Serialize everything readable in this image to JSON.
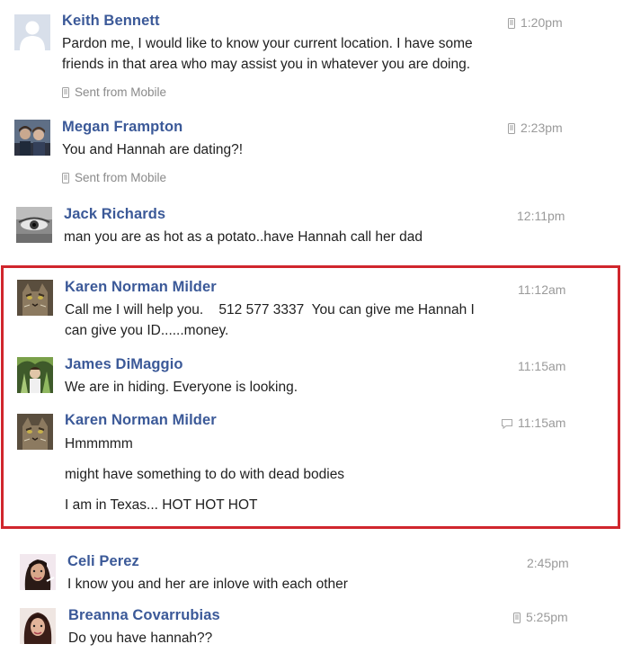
{
  "highlight_color": "#d0262d",
  "link_color": "#3b5998",
  "messages": [
    {
      "name": "Keith Bennett",
      "time": "1:20pm",
      "mobile": true,
      "lines": [
        "Pardon me, I would like to know your current location. I have some",
        "friends in that area who may assist you in whatever you are doing."
      ],
      "footer": "Sent from Mobile",
      "avatar": "default-silhouette"
    },
    {
      "name": "Megan Frampton",
      "time": "2:23pm",
      "mobile": true,
      "lines": [
        "You and Hannah are dating?!"
      ],
      "footer": "Sent from Mobile",
      "avatar": "photo"
    },
    {
      "name": "Jack Richards",
      "time": "12:11pm",
      "lines": [
        "man you are as hot as a potato..have Hannah call her dad"
      ],
      "avatar": "photo"
    },
    {
      "name": "Karen Norman Milder",
      "time": "11:12am",
      "lines": [
        "Call me I will help you.    512 577 3337  You can give me Hannah I",
        "can give you ID......money."
      ],
      "avatar": "cat-photo"
    },
    {
      "name": "James DiMaggio",
      "time": "11:15am",
      "lines": [
        "We are in hiding. Everyone is looking."
      ],
      "avatar": "photo"
    },
    {
      "name": "Karen Norman Milder",
      "time": "11:15am",
      "chat": true,
      "lines": [
        "Hmmmmm",
        "might have something to do with dead bodies",
        "I am in Texas... HOT HOT HOT"
      ],
      "avatar": "cat-photo"
    },
    {
      "name": "Celi Perez",
      "time": "2:45pm",
      "lines": [
        "I know you and her are inlove with each other"
      ],
      "avatar": "photo"
    },
    {
      "name": "Breanna Covarrubias",
      "time": "5:25pm",
      "mobile": true,
      "lines": [
        "Do you have hannah??"
      ],
      "avatar": "photo"
    }
  ]
}
